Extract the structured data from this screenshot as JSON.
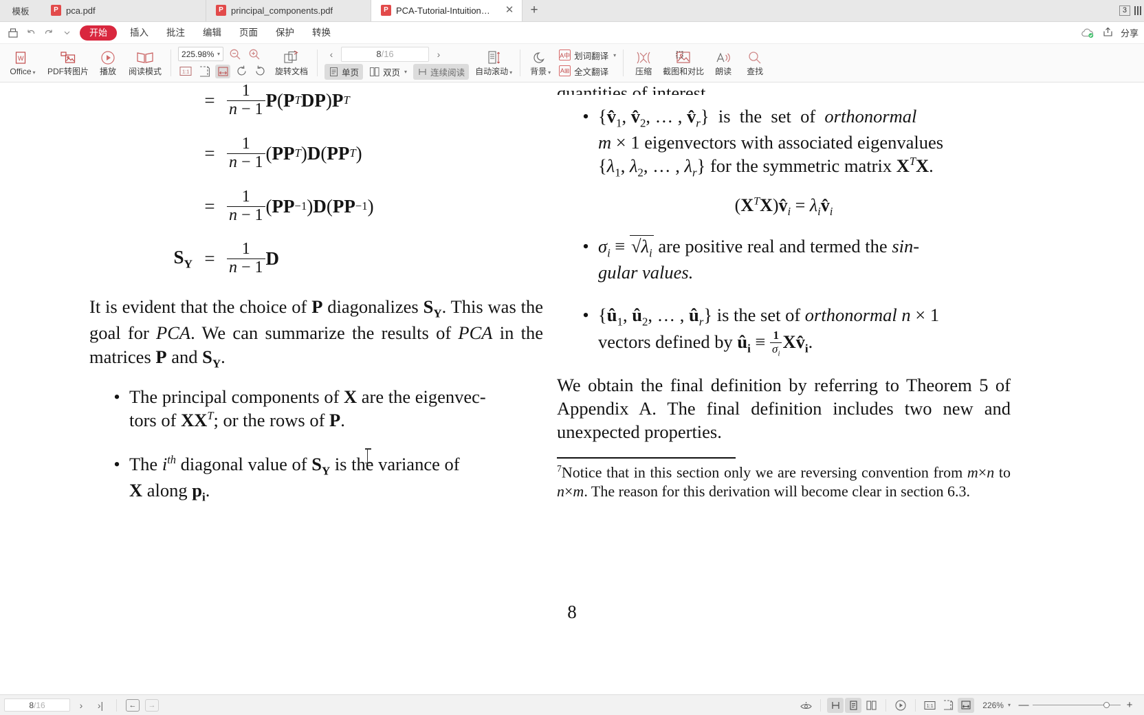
{
  "tabbar": {
    "template_tab": "模板",
    "tabs": [
      {
        "label": "pca.pdf",
        "icon": "pdf-file-icon",
        "active": false
      },
      {
        "label": "principal_components.pdf",
        "icon": "pdf-file-icon",
        "active": false
      },
      {
        "label": "PCA-Tutorial-Intuition_jp.pdf",
        "icon": "pdf-file-icon",
        "active": true
      }
    ],
    "close_glyph": "✕",
    "new_tab_glyph": "+",
    "window_badge": "3"
  },
  "menu": {
    "save_icon": "save-icon",
    "undo_icon": "undo-icon",
    "redo_icon": "redo-icon",
    "more_icon": "chevron-down-icon",
    "items": [
      {
        "label": "开始",
        "active": true
      },
      {
        "label": "插入",
        "active": false
      },
      {
        "label": "批注",
        "active": false
      },
      {
        "label": "编辑",
        "active": false
      },
      {
        "label": "页面",
        "active": false
      },
      {
        "label": "保护",
        "active": false
      },
      {
        "label": "转换",
        "active": false
      }
    ],
    "cloud_label": "",
    "share_label": "分享"
  },
  "toolbar": {
    "office": "Office",
    "pdf_to_image": "PDF转图片",
    "play": "播放",
    "read_mode": "阅读模式",
    "zoom_value": "225.98%",
    "zoom_out_icon": "zoom-out-icon",
    "zoom_in_icon": "zoom-in-icon",
    "fit_actual": "1:1",
    "fit_page_icon": "fit-page-icon",
    "fit_width_icon": "fit-width-icon",
    "rotate_cw_icon": "rotate-clockwise-icon",
    "rotate_ccw_icon": "rotate-counterclockwise-icon",
    "rotate_doc": "旋转文档",
    "page_current": "8",
    "page_total": "/16",
    "prev_page_icon": "chevron-left-icon",
    "next_page_icon": "chevron-right-icon",
    "single_page": "单页",
    "double_page": "双页",
    "continuous_read": "连续阅读",
    "auto_scroll": "自动滚动",
    "background": "背景",
    "word_translate": "划词翻译",
    "full_translate": "全文翻译",
    "compress": "压缩",
    "screenshot_compare": "截图和对比",
    "read_aloud": "朗读",
    "find": "查找"
  },
  "document": {
    "page_number": "8",
    "left_column": {
      "equations": [
        {
          "lhs": "",
          "eq": "=",
          "num": "1",
          "den": "n − 1",
          "body_html": "<span class='mb'>P</span>(<span class='mb'>P</span><span class='sup'>T</span><span class='mb'>DP</span>)<span class='mb'>P</span><span class='sup'>T</span>"
        },
        {
          "lhs": "",
          "eq": "=",
          "num": "1",
          "den": "n − 1",
          "body_html": "(<span class='mb'>PP</span><span class='sup'>T</span>)<span class='mb'>D</span>(<span class='mb'>PP</span><span class='sup'>T</span>)"
        },
        {
          "lhs": "",
          "eq": "=",
          "num": "1",
          "den": "n − 1",
          "body_html": "(<span class='mb'>PP</span><span class='supn'>−1</span>)<span class='mb'>D</span>(<span class='mb'>PP</span><span class='supn'>−1</span>)"
        },
        {
          "lhs": "S_Y",
          "eq": "=",
          "num": "1",
          "den": "n − 1",
          "body_html": "<span class='mb'>D</span>"
        }
      ],
      "paragraph": "It is evident that the choice of P diagonalizes S_Y. This was the goal for PCA. We can summarize the results of PCA in the matrices P and S_Y.",
      "bullets": [
        "The principal components of X are the eigenvectors of XX^T; or the rows of P.",
        "The i^th diagonal value of S_Y is the variance of X along p_i."
      ]
    },
    "right_column": {
      "cut_line": "quantities of interest.",
      "bullets": [
        "{v̂_1, v̂_2, …, v̂_r} is the set of orthonormal m × 1 eigenvectors with associated eigenvalues {λ_1, λ_2, …, λ_r} for the symmetric matrix X^T X.",
        "σ_i ≡ √λ_i are positive real and termed the singular values.",
        "{û_1, û_2, …, û_r} is the set of orthonormal n × 1 vectors defined by û_i ≡ (1/σ_i) X v̂_i."
      ],
      "centered_equation": "(X^T X) v̂_i = λ_i v̂_i",
      "paragraph": "We obtain the final definition by referring to Theorem 5 of Appendix A. The final definition includes two new and unexpected properties.",
      "footnote": "Notice that in this section only we are reversing convention from m×n to n×m. The reason for this derivation will become clear in section 6.3.",
      "footnote_mark": "7"
    }
  },
  "statusbar": {
    "page_current": "8",
    "page_total": "/16",
    "next_page_icon": "chevron-right-icon",
    "last_page_icon": "last-page-icon",
    "prev_view_icon": "back-arrow-icon",
    "next_view_icon": "forward-arrow-icon",
    "eye_icon": "eye-icon",
    "continuous_icon": "continuous-scroll-icon",
    "single_page_icon": "single-page-icon",
    "double_page_icon": "double-page-icon",
    "play_icon": "play-icon",
    "actual_size": "1:1",
    "fit_page_icon": "fit-page-icon",
    "fit_width_icon": "fit-width-icon",
    "zoom_level": "226%",
    "zoom_caret": "▾",
    "minus": "—",
    "plus": "+"
  }
}
